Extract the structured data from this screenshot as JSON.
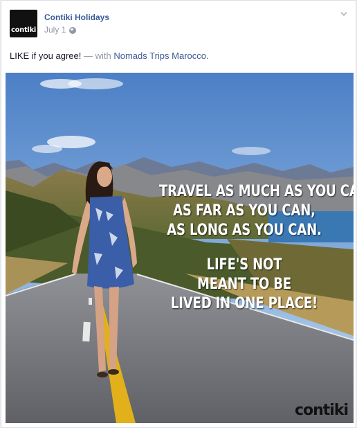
{
  "post": {
    "page_name": "Contiki Holidays",
    "avatar_text": "contiki",
    "date": "July 1",
    "audience_icon": "globe-icon",
    "menu_icon": "chevron-down-icon",
    "message": "LIKE if you agree!",
    "separator": "—",
    "with_word": "with",
    "tagged_page": "Nomads Trips Marocco."
  },
  "image": {
    "quote_lines_1": [
      "TRAVEL AS MUCH AS YOU CAN,",
      "AS FAR AS YOU CAN,",
      "AS LONG AS YOU CAN."
    ],
    "quote_lines_2": [
      "LIFE'S NOT",
      "MEANT TO BE",
      "LIVED IN ONE PLACE!"
    ],
    "watermark": "contiki"
  },
  "colors": {
    "link": "#3b5998",
    "meta": "#9197a3",
    "sky": "#5a86c8"
  }
}
